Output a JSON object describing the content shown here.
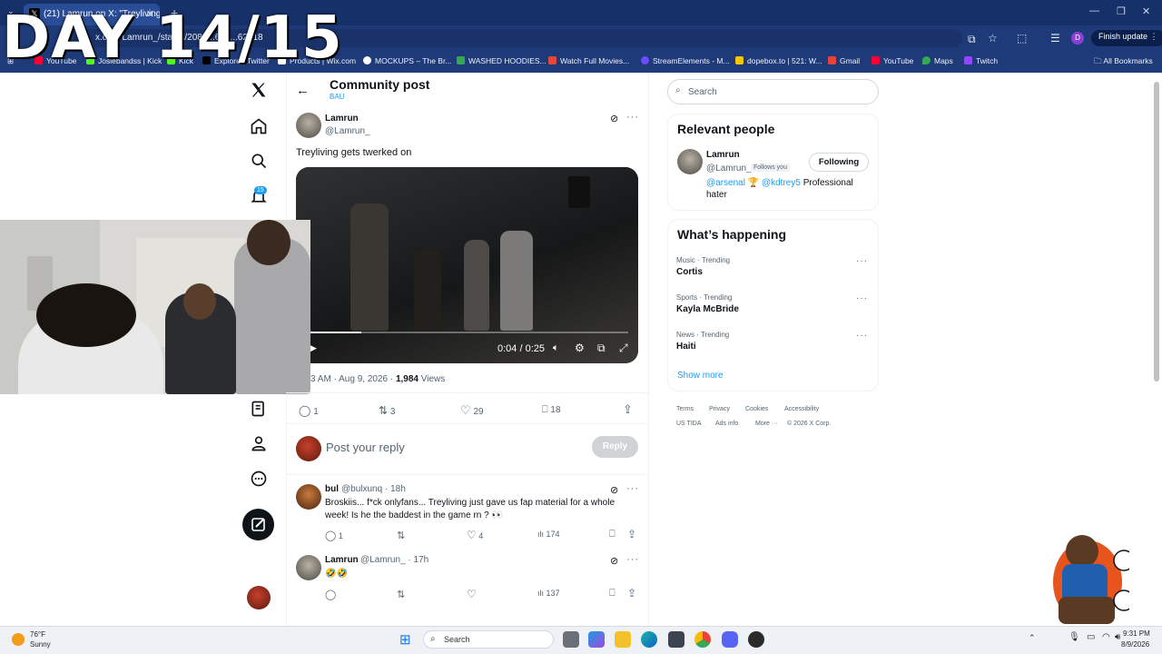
{
  "overlay": {
    "title": "DAY 14/15"
  },
  "browser": {
    "tab_title": "(21) Lamrun on X: \"Treyliving ge",
    "url": "x.com/Lamrun_/status/2084...616...62918",
    "finish_update": "Finish update",
    "profile_initial": "D",
    "bookmarks": [
      {
        "label": "YouTube",
        "color": "#ff0033"
      },
      {
        "label": "Josiebandss | Kick",
        "color": "#53fc18"
      },
      {
        "label": "Kick",
        "color": "#53fc18"
      },
      {
        "label": "Explore / Twitter",
        "color": "#000000"
      },
      {
        "label": "Products | Wix.com",
        "color": "#ffffff"
      },
      {
        "label": "MOCKUPS – The Br...",
        "color": "#ffffff"
      },
      {
        "label": "WASHED HOODIES...",
        "color": "#34a853"
      },
      {
        "label": "Watch Full Movies...",
        "color": "#e8453c"
      },
      {
        "label": "StreamElements - M...",
        "color": "#6b4dff"
      },
      {
        "label": "dopebox.to | 521: W...",
        "color": "#f7c600"
      },
      {
        "label": "Gmail",
        "color": "#ea4335"
      },
      {
        "label": "YouTube",
        "color": "#ff0033"
      },
      {
        "label": "Maps",
        "color": "#34a853"
      },
      {
        "label": "Twitch",
        "color": "#9146ff"
      }
    ],
    "all_bookmarks": "All Bookmarks"
  },
  "nav": {
    "notifications_count": "15"
  },
  "post": {
    "header_title": "Community post",
    "community": "BAU",
    "author_name": "Lamrun",
    "author_handle": "@Lamrun_",
    "text": "Treyliving gets twerked on",
    "video_time": "0:04 / 0:25",
    "timestamp_visible": "3 AM · Aug 9, 2026 · ",
    "views_count": "1,984",
    "views_label": " Views",
    "replies": "1",
    "reposts": "3",
    "likes": "29",
    "bookmarks": "18",
    "reply_placeholder": "Post your reply",
    "reply_button": "Reply"
  },
  "replies": [
    {
      "name": "bul",
      "handle": "@bulxunq · 18h",
      "text": "Broskiis... f*ck onlyfans... Treyliving just gave us fap material for a whole week! Is he the baddest in the game rn ? 👀",
      "replies": "1",
      "likes": "4",
      "views": "174"
    },
    {
      "name": "Lamrun",
      "handle": "@Lamrun_ · 17h",
      "text": "🤣🤣",
      "views": "137"
    }
  ],
  "sidebar": {
    "search_placeholder": "Search",
    "relevant_title": "Relevant people",
    "person_name": "Lamrun",
    "person_handle": "@Lamrun_",
    "follows_you": "Follows you",
    "following_button": "Following",
    "bio_link1": "@arsenal",
    "bio_emoji": "🏆",
    "bio_link2": "@kdtrey5",
    "bio_text1": " Professional",
    "bio_text2": "hater",
    "happening_title": "What’s happening",
    "trends": [
      {
        "category": "Music · Trending",
        "name": "Cortis"
      },
      {
        "category": "Sports · Trending",
        "name": "Kayla McBride"
      },
      {
        "category": "News · Trending",
        "name": "Haiti"
      }
    ],
    "show_more": "Show more",
    "footer": [
      "Terms",
      "Privacy",
      "Cookies",
      "Accessibility",
      "US TIDA",
      "Ads info",
      "More ···",
      "© 2026 X Corp."
    ]
  },
  "taskbar": {
    "weather_temp": "76°F",
    "weather_desc": "Sunny",
    "search_label": "Search",
    "time": "9:31 PM",
    "date": "8/9/2026"
  }
}
